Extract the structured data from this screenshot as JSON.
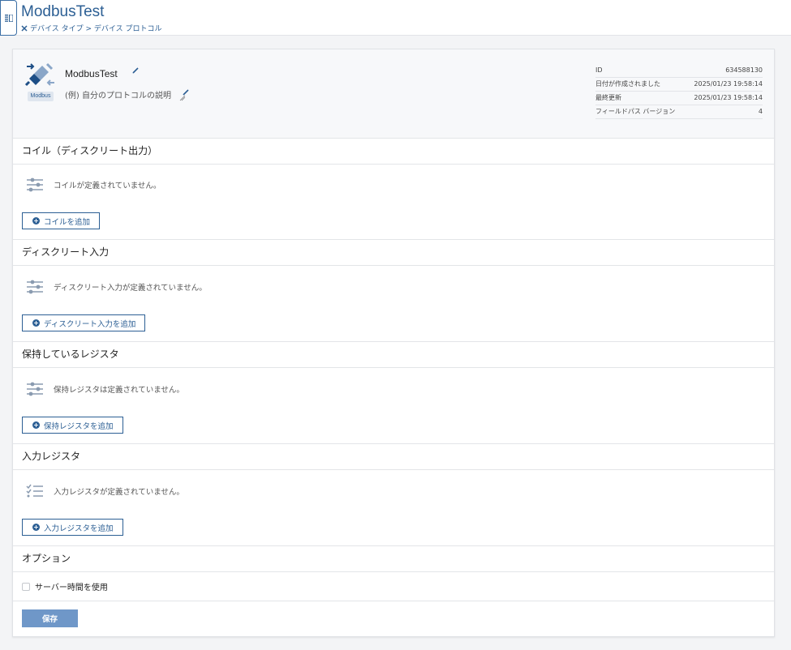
{
  "header": {
    "title": "ModbusTest",
    "breadcrumb": "デバイス タイプ > デバイス プロトコル"
  },
  "protocol": {
    "logo_label": "Modbus",
    "name": "ModbusTest",
    "description": "(例) 自分のプロトコルの説明"
  },
  "meta": [
    {
      "label": "ID",
      "value": "634588130"
    },
    {
      "label": "日付が作成されました",
      "value": "2025/01/23 19:58:14"
    },
    {
      "label": "最終更新",
      "value": "2025/01/23 19:58:14"
    },
    {
      "label": "フィールドパス バージョン",
      "value": "4"
    }
  ],
  "sections": [
    {
      "title": "コイル（ディスクリート出力）",
      "empty": "コイルが定義されていません。",
      "button": "コイルを追加"
    },
    {
      "title": "ディスクリート入力",
      "empty": "ディスクリート入力が定義されていません。",
      "button": "ディスクリート入力を追加"
    },
    {
      "title": "保持しているレジスタ",
      "empty": "保持レジスタは定義されていません。",
      "button": "保持レジスタを追加"
    },
    {
      "title": "入力レジスタ",
      "empty": "入力レジスタが定義されていません。",
      "button": "入力レジスタを追加"
    }
  ],
  "options": {
    "title": "オプション",
    "server_time_label": "サーバー時間を使用",
    "server_time_checked": false
  },
  "save_label": "保存",
  "colors": {
    "accent": "#2c5f94",
    "save": "#6f97c8"
  }
}
